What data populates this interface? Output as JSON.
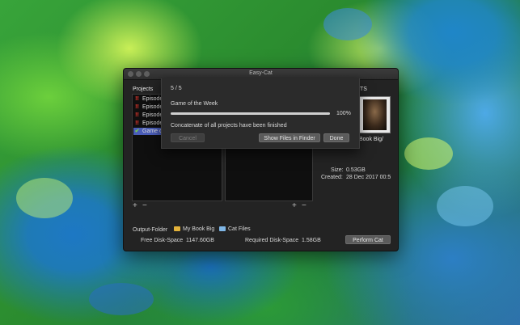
{
  "window": {
    "title": "Easy-Cat"
  },
  "projects": {
    "label": "Projects",
    "items": [
      {
        "icon": "warning-icon",
        "label": "Episode",
        "selected": false
      },
      {
        "icon": "warning-icon",
        "label": "Episode",
        "selected": false
      },
      {
        "icon": "warning-icon",
        "label": "Episode",
        "selected": false
      },
      {
        "icon": "warning-icon",
        "label": "Episode",
        "selected": false
      },
      {
        "icon": "checkmark-icon",
        "label": "Game of",
        "selected": true
      }
    ]
  },
  "details": {
    "label": "TS",
    "path": "Book Big/",
    "size_label": "Size:",
    "size_value": "0.53GB",
    "created_label": "Created:",
    "created_value": "28 Dec 2017 00:5"
  },
  "footer": {
    "output_folder_label": "Output-Folder",
    "folder1": "My Book Big",
    "folder2": "Cat Files",
    "free_label": "Free Disk-Space",
    "free_value": "1147.60GB",
    "required_label": "Required Disk-Space",
    "required_value": "1.58GB",
    "perform_label": "Perform Cat"
  },
  "controls": {
    "add": "+",
    "remove": "−"
  },
  "progress_sheet": {
    "counter": "5 / 5",
    "item_title": "Game of the Week",
    "progress": 1.0,
    "percent": "100%",
    "message": "Concatenate of all projects have been finished",
    "cancel_label": "Cancel",
    "show_label": "Show Files in Finder",
    "done_label": "Done"
  },
  "colors": {
    "selection": "#4a5db8",
    "warning": "#ff3b30",
    "success": "#7ad14b",
    "window_bg": "#232323"
  }
}
